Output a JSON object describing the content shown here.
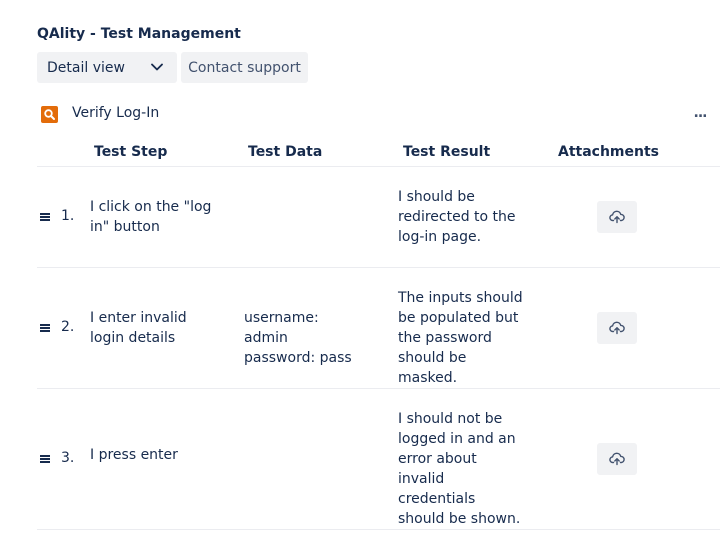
{
  "app": {
    "title": "QAlity - Test Management"
  },
  "toolbar": {
    "view_select": {
      "selected": "Detail view"
    },
    "contact_support_label": "Contact support"
  },
  "test_case": {
    "icon": "search-icon",
    "name": "Verify Log-In",
    "more_label": "..."
  },
  "table": {
    "columns": [
      "Test Step",
      "Test Data",
      "Test Result",
      "Attachments"
    ],
    "rows": [
      {
        "number": "1.",
        "step": "I click on the \"log in\" button",
        "data": "",
        "result": "I should be redirected to the log-in page.",
        "attachment_icon": "cloud-upload-icon"
      },
      {
        "number": "2.",
        "step": "I enter invalid login details",
        "data": "username: admin password: pass",
        "result": "The inputs should be populated but the password should be masked.",
        "attachment_icon": "cloud-upload-icon"
      },
      {
        "number": "3.",
        "step": "I press enter",
        "data": "",
        "result": "I should not be logged in and an error about invalid credentials should be shown.",
        "attachment_icon": "cloud-upload-icon"
      }
    ]
  },
  "colors": {
    "accent_orange": "#e36c0a",
    "text": "#172b4d",
    "button_bg": "#f1f2f4",
    "divider": "#ebecf0"
  }
}
